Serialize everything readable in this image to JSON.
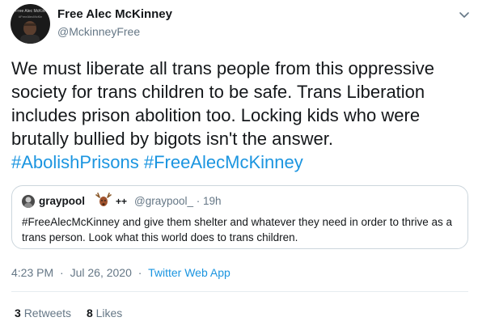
{
  "author": {
    "display_name": "Free Alec McKinney",
    "handle": "@MckinneyFree",
    "avatar_banner": "Free Alec McKinney",
    "avatar_subbanner": "#FreeAlecMcKinney"
  },
  "tweet": {
    "text": "We must liberate all trans people from this oppressive society for trans children to be safe. Trans Liberation includes prison abolition too. Locking kids who were brutally bullied by bigots isn't the answer.",
    "hashtags": [
      "#AbolishPrisons",
      "#FreeAlecMcKinney"
    ]
  },
  "quoted_tweet": {
    "name": "graypool",
    "name_suffix": "++",
    "handle": "@graypool_",
    "separator": "·",
    "time": "19h",
    "text": "#FreeAlecMcKinney and give them shelter and whatever they need in order to thrive as a trans person. Look what this world does to trans children."
  },
  "meta": {
    "time": "4:23 PM",
    "separator": "·",
    "date": "Jul 26, 2020",
    "source": "Twitter Web App"
  },
  "stats": {
    "retweets_count": "3",
    "retweets_label": "Retweets",
    "likes_count": "8",
    "likes_label": "Likes"
  },
  "colors": {
    "link": "#1b95e0",
    "secondary_text": "#657786",
    "border": "#ccd6dd"
  },
  "icons": {
    "caret": "chevron-down-icon",
    "emoji": "deer-emoji-icon"
  }
}
